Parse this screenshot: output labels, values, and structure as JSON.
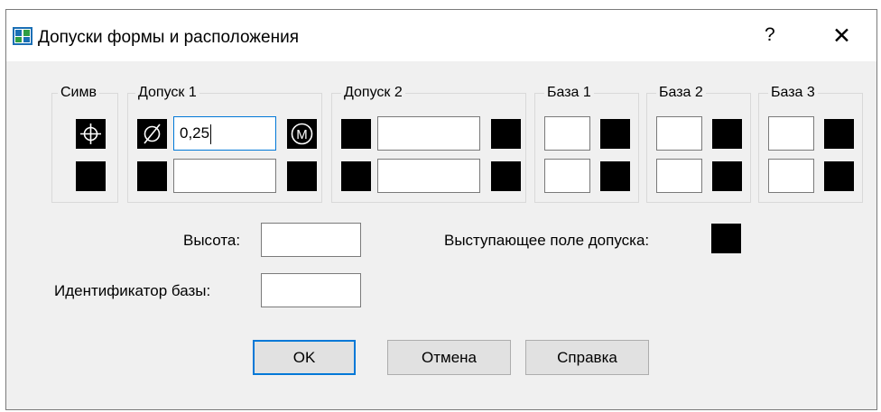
{
  "window": {
    "title": "Допуски формы и расположения",
    "help_glyph": "?",
    "close_glyph": "✕"
  },
  "groups": {
    "symbol": "Симв",
    "tolerance1": "Допуск 1",
    "tolerance2": "Допуск 2",
    "datum1": "База 1",
    "datum2": "База 2",
    "datum3": "База 3"
  },
  "tolerance1": {
    "diameter_glyph": "⌀",
    "value1": "0,25",
    "value2": "",
    "modifier_glyph": "M"
  },
  "tolerance2": {
    "value1": "",
    "value2": ""
  },
  "datums": {
    "datum1": {
      "value1": "",
      "value2": ""
    },
    "datum2": {
      "value1": "",
      "value2": ""
    },
    "datum3": {
      "value1": "",
      "value2": ""
    }
  },
  "icons": {
    "symbol": "position-symbol-icon",
    "diameter": "diameter-icon",
    "material_condition": "max-material-condition-icon"
  },
  "fields": {
    "height_label": "Высота:",
    "height_value": "",
    "projected_zone_label": "Выступающее поле допуска:",
    "datum_id_label": "Идентификатор базы:",
    "datum_id_value": ""
  },
  "buttons": {
    "ok": "OK",
    "cancel": "Отмена",
    "help": "Справка"
  },
  "colors": {
    "dialog_bg": "#f0f0f0",
    "focus_accent": "#0078d7",
    "swatch": "#000000"
  }
}
